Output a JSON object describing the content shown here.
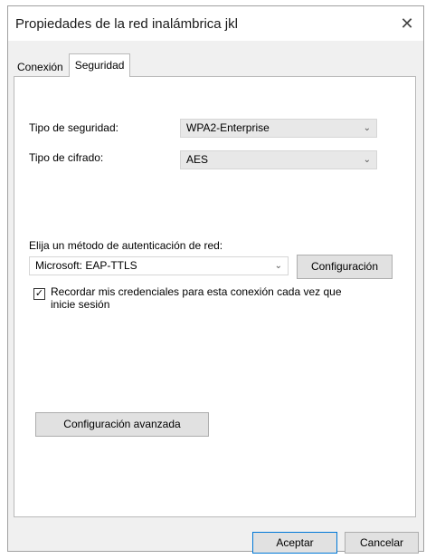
{
  "window": {
    "title": "Propiedades de la red inalámbrica jkl",
    "close_glyph": "✕"
  },
  "tabs": [
    {
      "label": "Conexión",
      "active": false
    },
    {
      "label": "Seguridad",
      "active": true
    }
  ],
  "security": {
    "type_label": "Tipo de seguridad:",
    "type_value": "WPA2-Enterprise",
    "encryption_label": "Tipo de cifrado:",
    "encryption_value": "AES"
  },
  "auth": {
    "method_label": "Elija un método de autenticación de red:",
    "method_value": "Microsoft: EAP-TTLS",
    "settings_button": "Configuración",
    "remember_checked": true,
    "remember_label": "Recordar mis credenciales para esta conexión cada vez que inicie sesión"
  },
  "advanced_button": "Configuración avanzada",
  "footer": {
    "ok": "Aceptar",
    "cancel": "Cancelar"
  },
  "icons": {
    "dropdown": "chevron-down-icon",
    "close": "close-icon",
    "check": "checkmark-icon"
  }
}
